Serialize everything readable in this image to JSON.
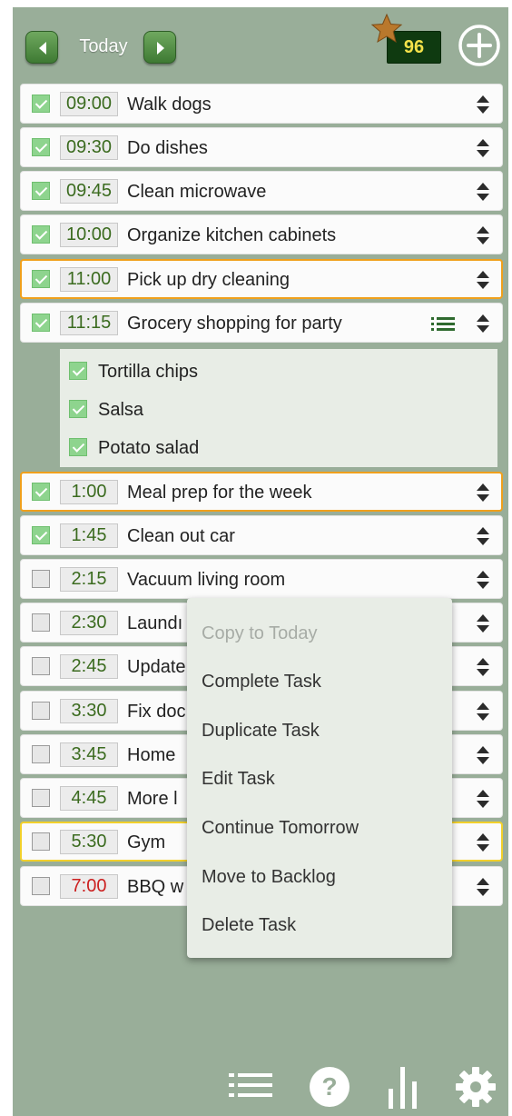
{
  "header": {
    "day_label": "Today",
    "score": "96"
  },
  "tasks": [
    {
      "time": "09:00",
      "title": "Walk dogs",
      "done": true
    },
    {
      "time": "09:30",
      "title": "Do dishes",
      "done": true
    },
    {
      "time": "09:45",
      "title": "Clean microwave",
      "done": true
    },
    {
      "time": "10:00",
      "title": "Organize kitchen cabinets",
      "done": true
    },
    {
      "time": "11:00",
      "title": "Pick up dry cleaning",
      "done": true,
      "highlight": "orange"
    },
    {
      "time": "11:15",
      "title": "Grocery shopping for party",
      "done": true,
      "has_subtasks": true
    },
    {
      "time": "1:00",
      "title": "Meal prep for the week",
      "done": true,
      "highlight": "orange"
    },
    {
      "time": "1:45",
      "title": "Clean out car",
      "done": true
    },
    {
      "time": "2:15",
      "title": "Vacuum living room",
      "done": false
    },
    {
      "time": "2:30",
      "title": "Laundı",
      "done": false
    },
    {
      "time": "2:45",
      "title": "Update",
      "done": false
    },
    {
      "time": "3:30",
      "title": "Fix doc",
      "done": false
    },
    {
      "time": "3:45",
      "title": "Home",
      "done": false
    },
    {
      "time": "4:45",
      "title": "More l",
      "done": false
    },
    {
      "time": "5:30",
      "title": "Gym",
      "done": false,
      "highlight": "yellow"
    },
    {
      "time": "7:00",
      "title": "BBQ w",
      "done": false,
      "time_color": "#cc2020"
    }
  ],
  "subtasks": [
    {
      "title": "Tortilla chips",
      "done": true
    },
    {
      "title": "Salsa",
      "done": true
    },
    {
      "title": "Potato salad",
      "done": true
    }
  ],
  "context_menu": {
    "items": [
      {
        "label": "Copy to Today",
        "enabled": false
      },
      {
        "label": "Complete Task",
        "enabled": true
      },
      {
        "label": "Duplicate Task",
        "enabled": true
      },
      {
        "label": "Edit Task",
        "enabled": true
      },
      {
        "label": "Continue Tomorrow",
        "enabled": true
      },
      {
        "label": "Move to Backlog",
        "enabled": true
      },
      {
        "label": "Delete Task",
        "enabled": true
      }
    ]
  },
  "bottom_bar": {
    "icons": [
      "list-icon",
      "help-icon",
      "stats-icon",
      "settings-icon"
    ]
  },
  "colors": {
    "background": "#99ae99",
    "done_check": "#8ed48e",
    "highlight_orange": "#f0a01c",
    "highlight_yellow": "#f2d02a",
    "score_text": "#f4e24a",
    "score_bg": "#0f3a10"
  }
}
